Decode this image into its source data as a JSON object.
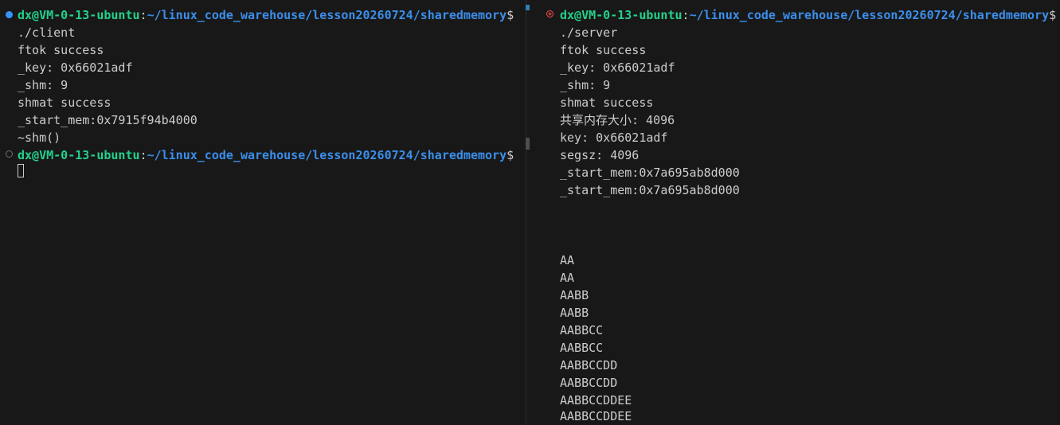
{
  "terminals": [
    {
      "id": "client",
      "blocks": [
        {
          "prompt": {
            "user_host": "dx@VM-0-13-ubuntu",
            "sep": ":",
            "path": "~/linux_code_warehouse/lesson20260724/sharedmemory",
            "dollar": "$"
          },
          "command": "./client",
          "output": [
            "ftok success",
            "_key: 0x66021adf",
            "_shm: 9",
            "shmat success",
            "_start_mem:0x7915f94b4000",
            "~shm()"
          ]
        },
        {
          "prompt": {
            "user_host": "dx@VM-0-13-ubuntu",
            "sep": ":",
            "path": "~/linux_code_warehouse/lesson20260724/sharedmemory",
            "dollar": "$"
          },
          "command": "",
          "output": []
        }
      ]
    },
    {
      "id": "server",
      "blocks": [
        {
          "prompt": {
            "user_host": "dx@VM-0-13-ubuntu",
            "sep": ":",
            "path": "~/linux_code_warehouse/lesson20260724/sharedmemory",
            "dollar": "$"
          },
          "command": "./server",
          "output": [
            "ftok success",
            "_key: 0x66021adf",
            "_shm: 9",
            "shmat success",
            "共享内存大小: 4096",
            "key: 0x66021adf",
            "segsz: 4096",
            "_start_mem:0x7a695ab8d000",
            "_start_mem:0x7a695ab8d000",
            "",
            "",
            "",
            "",
            "AA",
            "AA",
            "AABB",
            "AABB",
            "AABBCC",
            "AABBCC",
            "AABBCCDD",
            "AABBCCDD",
            "AABBCCDDEE",
            "AABBCCDDEE"
          ]
        }
      ]
    }
  ]
}
